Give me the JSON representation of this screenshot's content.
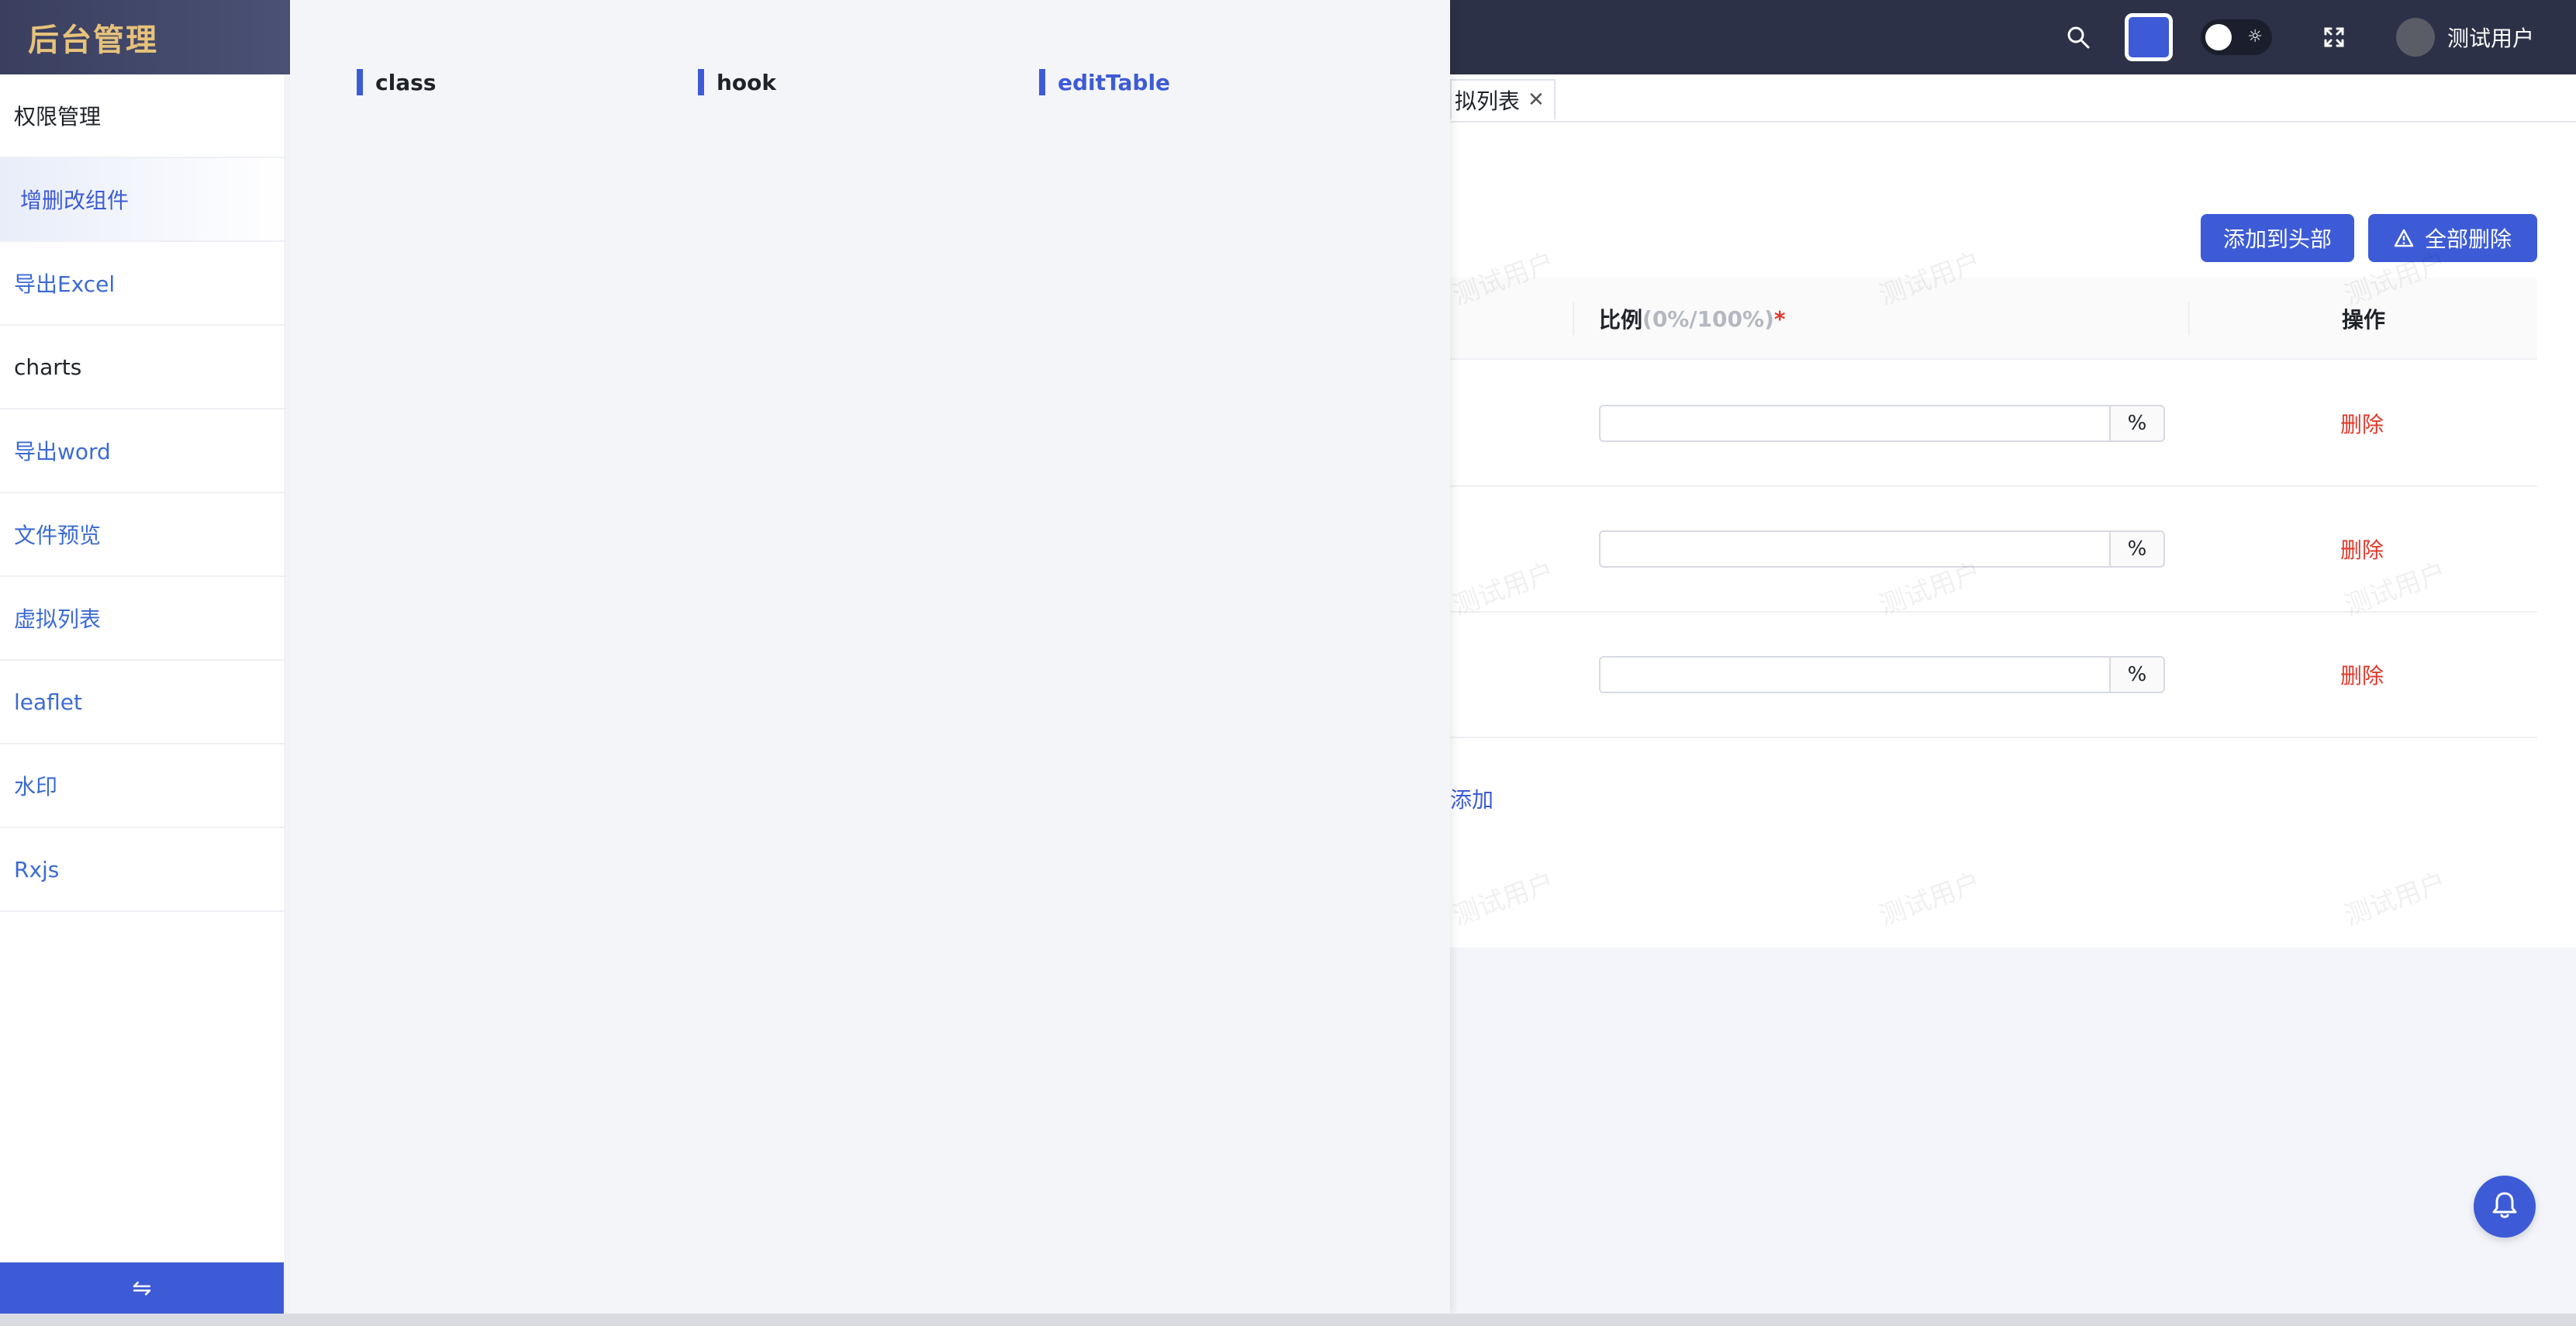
{
  "app": {
    "logo_text": "后台管理"
  },
  "header": {
    "user_name": "测试用户",
    "accent_color": "#3d5bd6",
    "icons": [
      "search-icon",
      "color-swatch",
      "theme-toggle",
      "fullscreen-icon",
      "avatar"
    ]
  },
  "sidebar": {
    "items": [
      {
        "label": "权限管理"
      },
      {
        "label": "增删改组件"
      },
      {
        "label": "导出Excel"
      },
      {
        "label": "charts"
      },
      {
        "label": "导出word"
      },
      {
        "label": "文件预览"
      },
      {
        "label": "虚拟列表"
      },
      {
        "label": "leaflet"
      },
      {
        "label": "水印"
      },
      {
        "label": "Rxjs"
      }
    ],
    "collapse_icon": "⇋"
  },
  "drawer": {
    "items": [
      {
        "label": "class"
      },
      {
        "label": "hook"
      },
      {
        "label": "editTable"
      }
    ]
  },
  "tabs": [
    {
      "label": "拟列表"
    }
  ],
  "toolbar": {
    "add_label": "添加到头部",
    "delete_all_label": "全部删除"
  },
  "table": {
    "headers": {
      "ratio": "比例",
      "ratio_hint": "(0%/100%)",
      "required_mark": "*",
      "operation": "操作"
    },
    "rows": [
      {
        "ratio_value": "",
        "unit": "%",
        "delete_label": "删除"
      },
      {
        "ratio_value": "",
        "unit": "%",
        "delete_label": "删除"
      },
      {
        "ratio_value": "",
        "unit": "%",
        "delete_label": "删除"
      }
    ],
    "add_row_label": "添加"
  },
  "watermark_text": "测试用户"
}
